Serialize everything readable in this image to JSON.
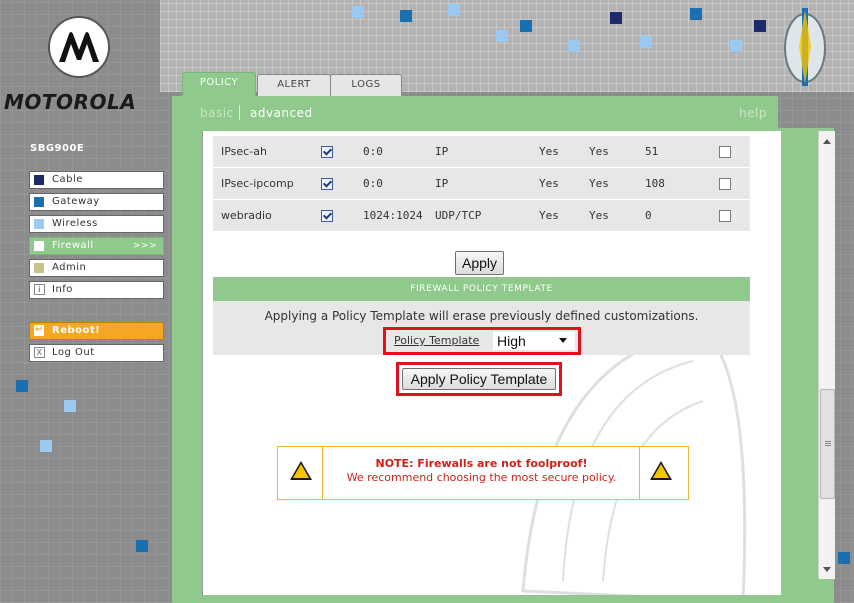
{
  "brand": {
    "name": "MOTOROLA",
    "model": "SBG900E"
  },
  "tabs": [
    {
      "label": "POLICY",
      "active": true
    },
    {
      "label": "ALERT",
      "active": false
    },
    {
      "label": "LOGS",
      "active": false
    }
  ],
  "subnav": {
    "basic": "basic",
    "advanced": "advanced",
    "help": "help"
  },
  "sidebar": {
    "items": [
      {
        "label": "Cable",
        "color": "#1f2a6b"
      },
      {
        "label": "Gateway",
        "color": "#1a6fb0"
      },
      {
        "label": "Wireless",
        "color": "#9cc9ef"
      },
      {
        "label": "Firewall",
        "color": "#ffffff",
        "active": true,
        "suffix": ">>>"
      },
      {
        "label": "Admin",
        "color": "#c8c28a"
      },
      {
        "label": "Info",
        "icon": "i"
      }
    ],
    "reboot": {
      "label": "Reboot!",
      "icon": "↩"
    },
    "logout": {
      "label": "Log Out",
      "icon": "X"
    }
  },
  "rules": [
    {
      "name": "IPsec-ah",
      "enabled": true,
      "ports": "0:0",
      "protocol": "IP",
      "col5": "Yes",
      "col6": "Yes",
      "id": "51",
      "delete": false
    },
    {
      "name": "IPsec-ipcomp",
      "enabled": true,
      "ports": "0:0",
      "protocol": "IP",
      "col5": "Yes",
      "col6": "Yes",
      "id": "108",
      "delete": false
    },
    {
      "name": "webradio",
      "enabled": true,
      "ports": "1024:1024",
      "protocol": "UDP/TCP",
      "col5": "Yes",
      "col6": "Yes",
      "id": "0",
      "delete": false
    }
  ],
  "apply_label": "Apply",
  "template": {
    "header": "FIREWALL POLICY TEMPLATE",
    "message": "Applying a Policy Template will erase previously defined customizations.",
    "label": "Policy Template",
    "selected": "High",
    "apply_label": "Apply Policy Template"
  },
  "note": {
    "title": "NOTE: Firewalls are not foolproof!",
    "subtitle": "We recommend choosing the most secure policy.",
    "icon": "warning-icon"
  },
  "colors": {
    "accent": "#8fc98b",
    "highlight": "#e0101e",
    "warning_text": "#d0211b"
  }
}
